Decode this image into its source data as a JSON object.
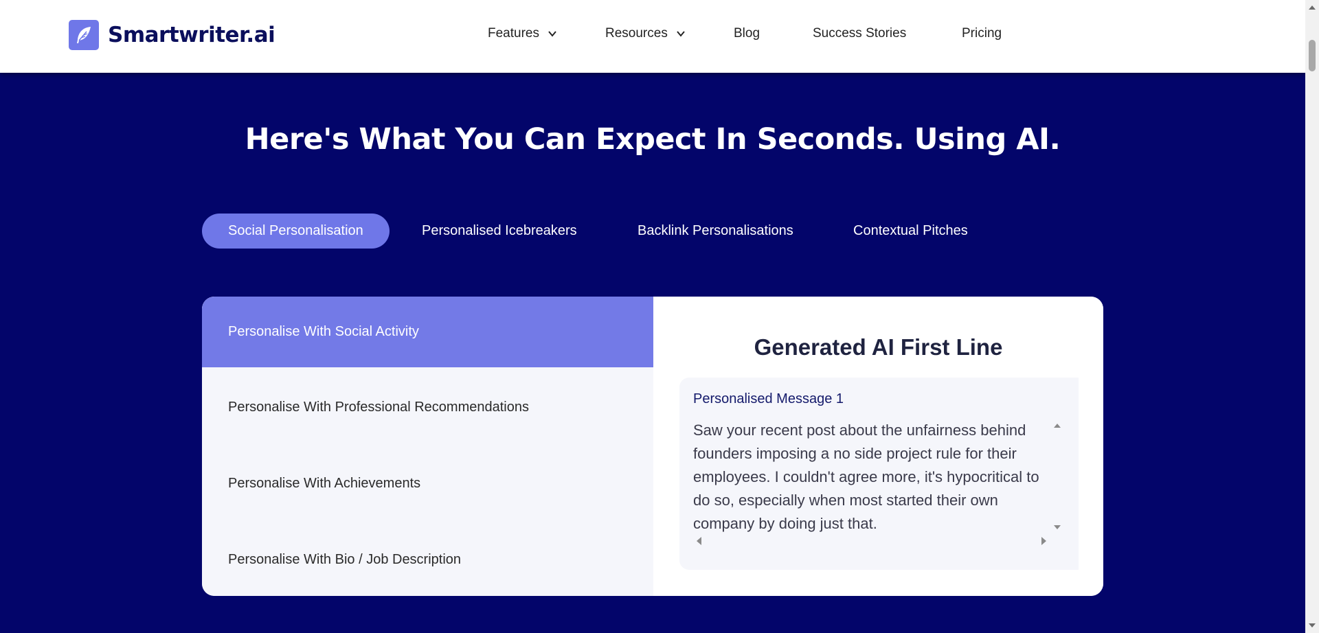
{
  "brand": {
    "name": "Smartwriter.ai",
    "logo_icon": "feather-icon"
  },
  "nav": [
    {
      "label": "Features",
      "dropdown": true
    },
    {
      "label": "Resources",
      "dropdown": true
    },
    {
      "label": "Blog",
      "dropdown": false
    },
    {
      "label": "Success Stories",
      "dropdown": false
    },
    {
      "label": "Pricing",
      "dropdown": false
    }
  ],
  "hero": {
    "title": "Here's What You Can Expect In Seconds. Using AI."
  },
  "tabs": [
    {
      "label": "Social Personalisation",
      "active": true
    },
    {
      "label": "Personalised Icebreakers",
      "active": false
    },
    {
      "label": "Backlink Personalisations",
      "active": false
    },
    {
      "label": "Contextual Pitches",
      "active": false
    }
  ],
  "options": [
    {
      "label": "Personalise With Social Activity",
      "active": true
    },
    {
      "label": "Personalise With Professional Recommendations",
      "active": false
    },
    {
      "label": "Personalise With Achievements",
      "active": false
    },
    {
      "label": "Personalise With Bio / Job Description",
      "active": false
    }
  ],
  "result": {
    "title": "Generated AI First Line",
    "message_label": "Personalised Message 1",
    "message_text": "Saw your recent post about the unfairness behind founders imposing a no side project rule for their employees. I couldn't agree more, it's hypocritical to do so, especially when most started their own company by doing just that."
  },
  "colors": {
    "background": "#03056a",
    "accent": "#6f77e8",
    "option_active": "#737ae7",
    "panel_light": "#f5f6fb"
  }
}
